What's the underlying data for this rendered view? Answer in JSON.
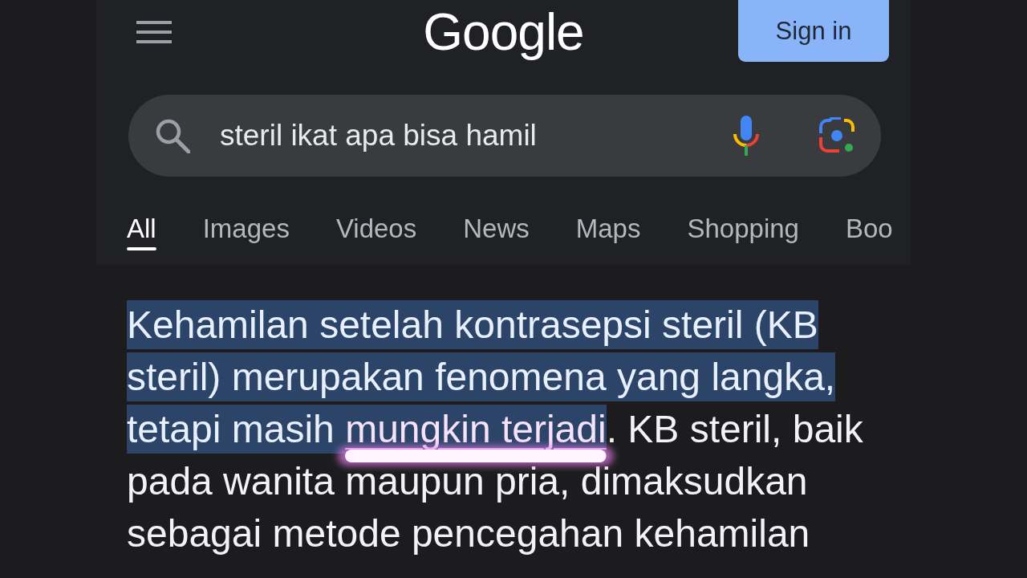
{
  "header": {
    "logo": "Google",
    "sign_in": "Sign in"
  },
  "search": {
    "value": "steril ikat apa bisa hamil"
  },
  "tabs": [
    {
      "label": "All",
      "selected": true
    },
    {
      "label": "Images",
      "selected": false
    },
    {
      "label": "Videos",
      "selected": false
    },
    {
      "label": "News",
      "selected": false
    },
    {
      "label": "Maps",
      "selected": false
    },
    {
      "label": "Shopping",
      "selected": false
    },
    {
      "label": "Boo",
      "selected": false
    }
  ],
  "snippet": {
    "segments": [
      {
        "text": "Kehamilan setelah kontrasepsi steril (KB steril) merupakan fenomena yang langka, tetapi masih ",
        "highlighted": true,
        "annotated": false
      },
      {
        "text": "mungkin terjadi",
        "highlighted": true,
        "annotated": true
      },
      {
        "text": ". KB steril, baik pada wanita maupun pria, dimaksudkan sebagai metode pencegahan kehamilan",
        "highlighted": false,
        "annotated": false
      }
    ]
  }
}
